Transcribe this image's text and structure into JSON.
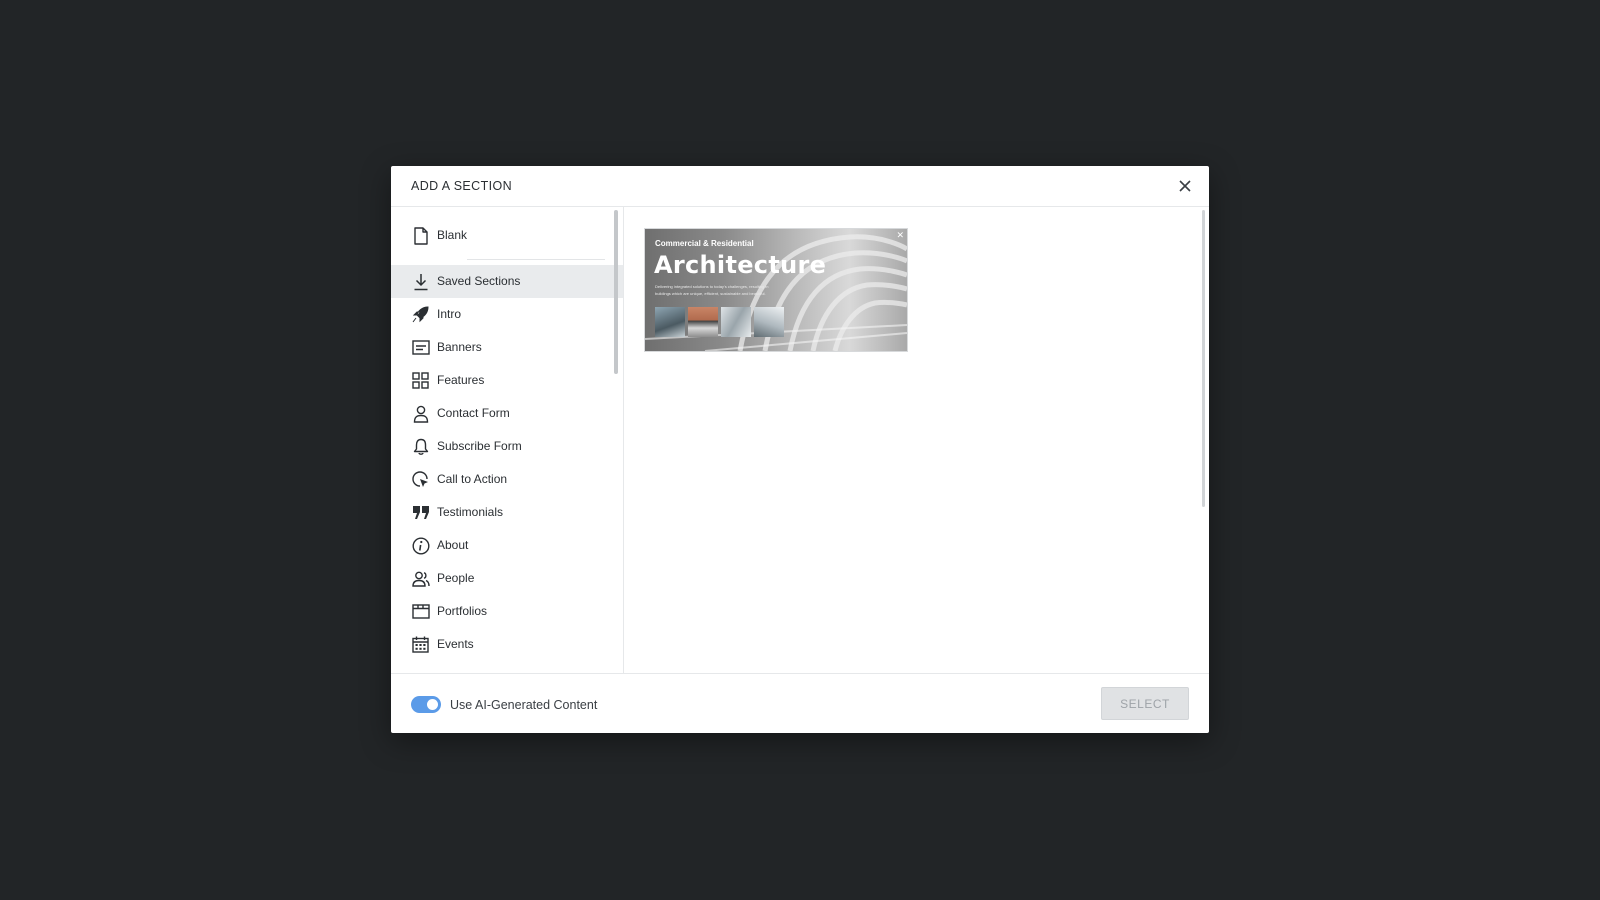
{
  "modal": {
    "title": "ADD A SECTION",
    "close_icon": "close-icon"
  },
  "sidebar": {
    "items": [
      {
        "label": "Blank",
        "icon": "document-icon"
      },
      {
        "label": "Saved Sections",
        "icon": "download-icon"
      },
      {
        "label": "Intro",
        "icon": "rocket-icon"
      },
      {
        "label": "Banners",
        "icon": "banner-icon"
      },
      {
        "label": "Features",
        "icon": "grid-icon"
      },
      {
        "label": "Contact Form",
        "icon": "person-icon"
      },
      {
        "label": "Subscribe Form",
        "icon": "bell-icon"
      },
      {
        "label": "Call to Action",
        "icon": "cursor-click-icon"
      },
      {
        "label": "Testimonials",
        "icon": "quote-icon"
      },
      {
        "label": "About",
        "icon": "info-icon"
      },
      {
        "label": "People",
        "icon": "people-icon"
      },
      {
        "label": "Portfolios",
        "icon": "portfolio-icon"
      },
      {
        "label": "Events",
        "icon": "calendar-icon"
      }
    ],
    "active": "Saved Sections"
  },
  "preview": {
    "subtitle": "Commercial & Residential",
    "title": "Architecture",
    "body": "Delivering integrated solutions to today's challenges, resulting in buildings which are unique, efficient, sustainable and beautiful."
  },
  "footer": {
    "toggle_label": "Use AI-Generated Content",
    "toggle_on": true,
    "select_label": "SELECT"
  },
  "colors": {
    "backdrop": "#222527",
    "accent": "#5b9be8",
    "active_item": "#e9ebed"
  }
}
